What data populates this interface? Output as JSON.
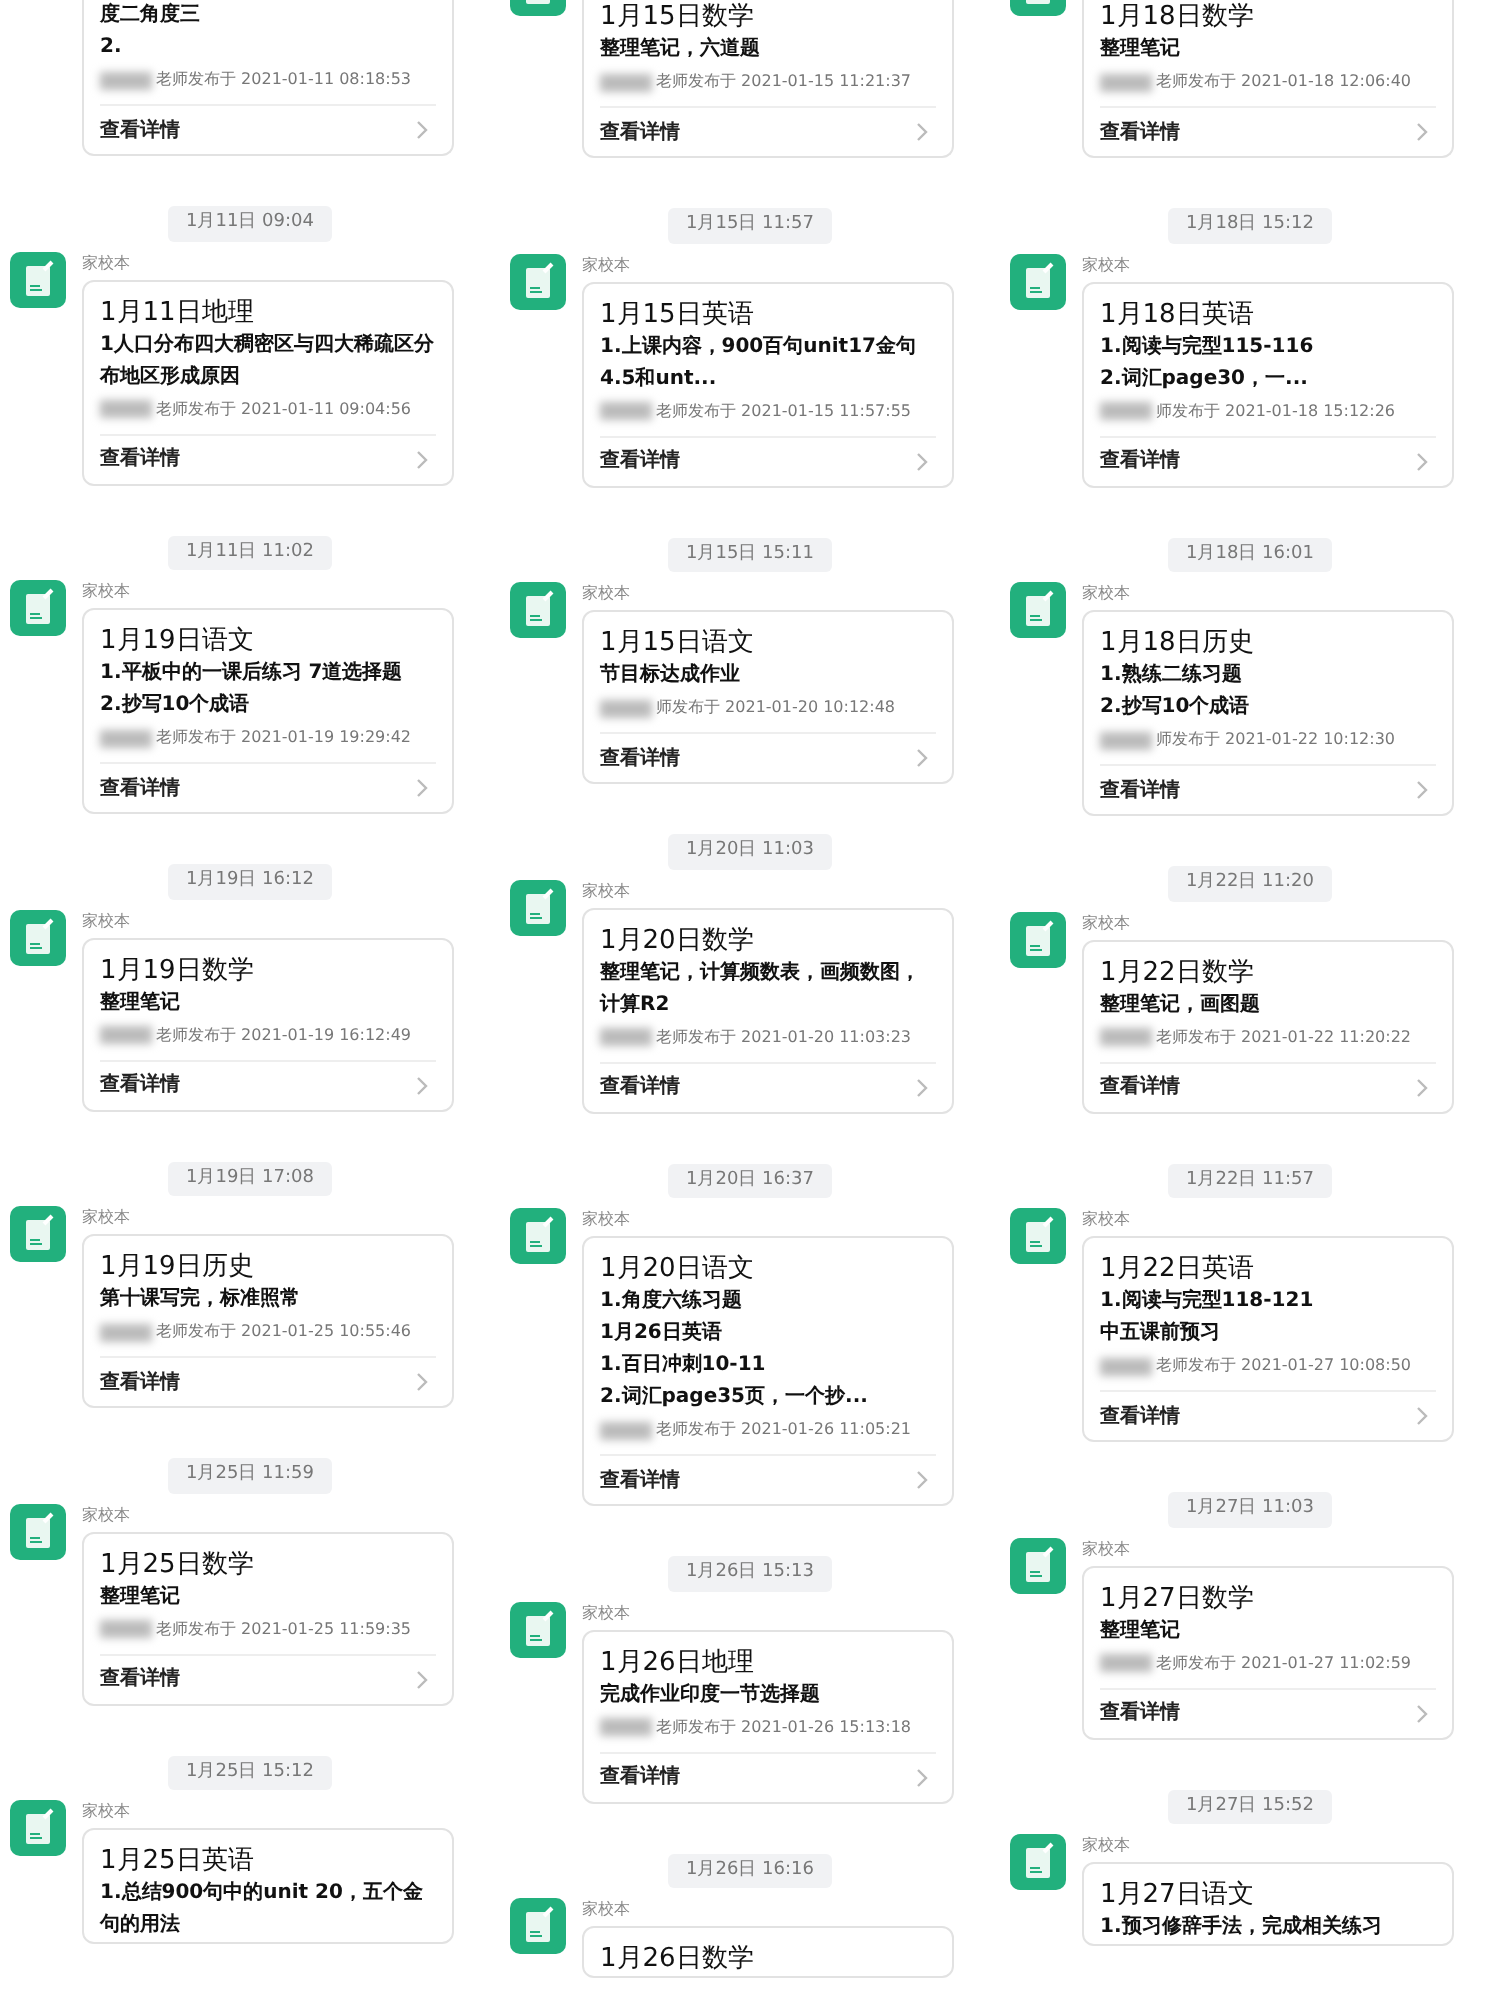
{
  "columns": [
    {
      "messages": [
        {
          "cut_top": true,
          "lines": [
            "度二角度三",
            "2."
          ],
          "meta": "老师发布于 2021-01-11 08:18:53",
          "link": "查看详情"
        },
        {
          "time": "1月11日 09:04",
          "sender": "家校本",
          "title": "1月11日地理",
          "lines": [
            "1人口分布四大稠密区与四大稀疏区分布地区形成原因"
          ],
          "meta": "老师发布于 2021-01-11 09:04:56",
          "link": "查看详情"
        },
        {
          "time": "1月11日 11:02",
          "sender": "家校本",
          "title": "1月19日语文",
          "lines": [
            "1.平板中的一课后练习 7道选择题",
            "2.抄写10个成语"
          ],
          "meta": "老师发布于 2021-01-19 19:29:42",
          "link": "查看详情"
        },
        {
          "time": "1月19日 16:12",
          "sender": "家校本",
          "title": "1月19日数学",
          "lines": [
            "整理笔记"
          ],
          "meta": "老师发布于 2021-01-19 16:12:49",
          "link": "查看详情"
        },
        {
          "time": "1月19日 17:08",
          "sender": "家校本",
          "title": "1月19日历史",
          "lines": [
            "第十课写完，标准照常"
          ],
          "meta": "老师发布于 2021-01-25 10:55:46",
          "link": "查看详情"
        },
        {
          "time": "1月25日 11:59",
          "sender": "家校本",
          "title": "1月25日数学",
          "lines": [
            "整理笔记"
          ],
          "meta": "老师发布于 2021-01-25 11:59:35",
          "link": "查看详情"
        },
        {
          "time": "1月25日 15:12",
          "sender": "家校本",
          "title": "1月25日英语",
          "lines": [
            "1.总结900句中的unit 20，五个金句的用法"
          ]
        }
      ]
    },
    {
      "messages": [
        {
          "cut_top": true,
          "title": "1月15日数学",
          "lines": [
            "整理笔记，六道题"
          ],
          "meta": "老师发布于 2021-01-15 11:21:37",
          "link": "查看详情"
        },
        {
          "time": "1月15日 11:57",
          "sender": "家校本",
          "title": "1月15日英语",
          "lines": [
            "1.上课内容，900百句unit17金句4.5和unt..."
          ],
          "meta": "老师发布于 2021-01-15 11:57:55",
          "link": "查看详情"
        },
        {
          "time": "1月15日 15:11",
          "sender": "家校本",
          "title": "1月15日语文",
          "lines": [
            "节目标达成作业"
          ],
          "meta": "师发布于 2021-01-20 10:12:48",
          "link": "查看详情"
        },
        {
          "time": "1月20日 11:03",
          "sender": "家校本",
          "title": "1月20日数学",
          "lines": [
            "整理笔记，计算频数表，画频数图，计算R2"
          ],
          "meta": "老师发布于 2021-01-20 11:03:23",
          "link": "查看详情"
        },
        {
          "time": "1月20日 16:37",
          "sender": "家校本",
          "title": "1月20日语文",
          "lines": [
            "1.角度六练习题",
            "1月26日英语",
            "1.百日冲刺10-11",
            "2.词汇page35页，一个抄..."
          ],
          "meta": "老师发布于 2021-01-26 11:05:21",
          "link": "查看详情"
        },
        {
          "time": "1月26日 15:13",
          "sender": "家校本",
          "title": "1月26日地理",
          "lines": [
            "完成作业印度一节选择题"
          ],
          "meta": "老师发布于 2021-01-26 15:13:18",
          "link": "查看详情"
        },
        {
          "time": "1月26日 16:16",
          "sender": "家校本",
          "title": "1月26日数学"
        }
      ]
    },
    {
      "messages": [
        {
          "cut_top": true,
          "title": "1月18日数学",
          "lines": [
            "整理笔记"
          ],
          "meta": "老师发布于 2021-01-18 12:06:40",
          "link": "查看详情"
        },
        {
          "time": "1月18日 15:12",
          "sender": "家校本",
          "title": "1月18日英语",
          "lines": [
            "1.阅读与完型115-116",
            "2.词汇page30，一..."
          ],
          "meta": "师发布于 2021-01-18 15:12:26",
          "link": "查看详情"
        },
        {
          "time": "1月18日 16:01",
          "sender": "家校本",
          "title": "1月18日历史",
          "lines": [
            "1.熟练二练习题",
            "2.抄写10个成语"
          ],
          "meta": "师发布于 2021-01-22 10:12:30",
          "link": "查看详情"
        },
        {
          "time": "1月22日 11:20",
          "sender": "家校本",
          "title": "1月22日数学",
          "lines": [
            "整理笔记，画图题"
          ],
          "meta": "老师发布于 2021-01-22 11:20:22",
          "link": "查看详情"
        },
        {
          "time": "1月22日 11:57",
          "sender": "家校本",
          "title": "1月22日英语",
          "lines": [
            "1.阅读与完型118-121",
            "中五课前预习"
          ],
          "meta": "老师发布于 2021-01-27 10:08:50",
          "link": "查看详情"
        },
        {
          "time": "1月27日 11:03",
          "sender": "家校本",
          "title": "1月27日数学",
          "lines": [
            "整理笔记"
          ],
          "meta": "老师发布于 2021-01-27 11:02:59",
          "link": "查看详情"
        },
        {
          "time": "1月27日 15:52",
          "sender": "家校本",
          "title": "1月27日语文",
          "lines": [
            "1.预习修辞手法，完成相关练习"
          ]
        }
      ]
    }
  ]
}
